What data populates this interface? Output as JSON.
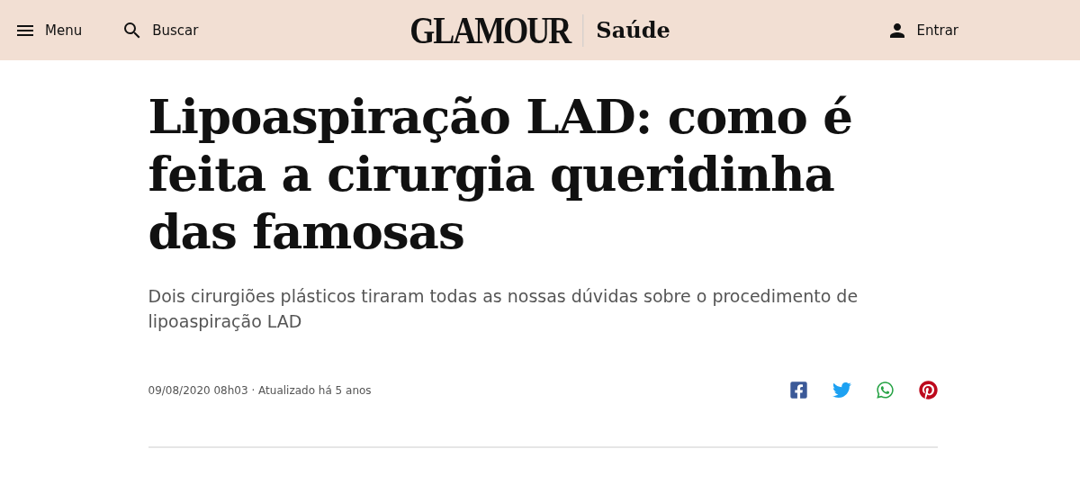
{
  "header": {
    "menu": "Menu",
    "search": "Buscar",
    "logo": "GLAMOUR",
    "section": "Saúde",
    "login": "Entrar"
  },
  "article": {
    "title": "Lipoaspiração LAD: como é feita a cirurgia queridinha das famosas",
    "subtitle": "Dois cirurgiões plásticos tiraram todas as nossas dúvidas sobre o procedimento de lipoaspiração LAD",
    "meta": "09/08/2020 08h03 · Atualizado há 5 anos",
    "share": [
      {
        "kind": "facebook",
        "color": "#3b5998"
      },
      {
        "kind": "twitter",
        "color": "#1da1f2"
      },
      {
        "kind": "whatsapp",
        "color": "#25a244"
      },
      {
        "kind": "pinterest",
        "color": "#bd081c"
      }
    ]
  }
}
